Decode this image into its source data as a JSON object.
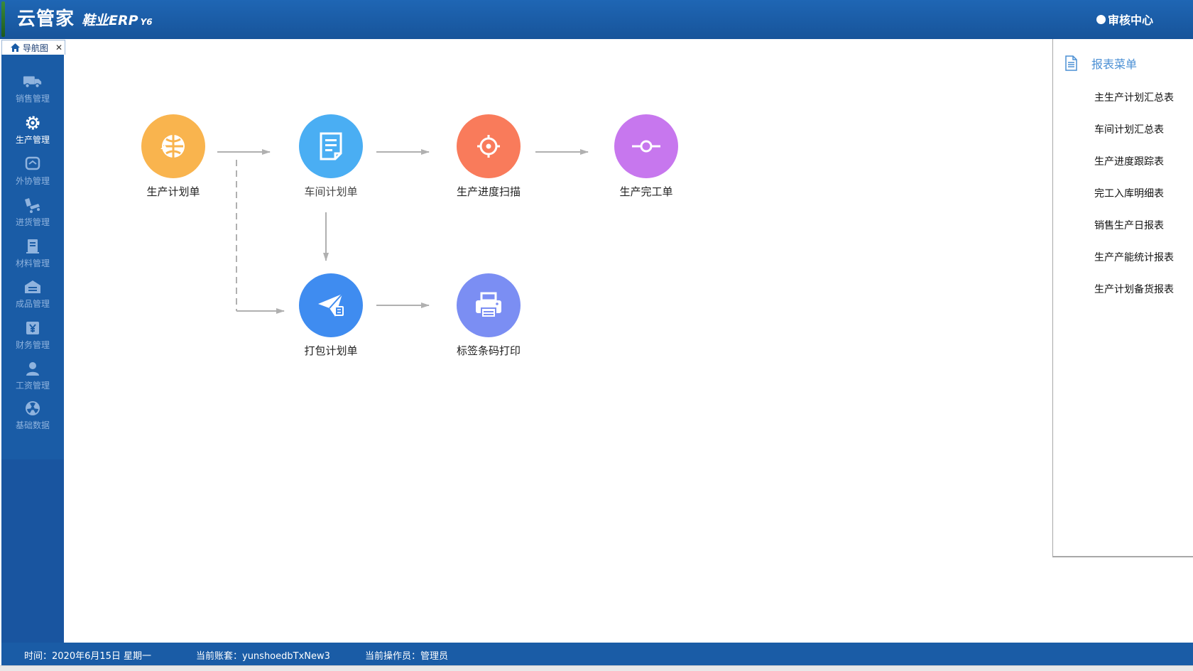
{
  "app": {
    "brand": "云管家",
    "product": "鞋业ERP",
    "version": "Y6",
    "audit_center": "审核中心"
  },
  "tabs": [
    {
      "label": "导航图"
    }
  ],
  "sidebar": {
    "items": [
      {
        "label": "销售管理",
        "icon": "truck-icon"
      },
      {
        "label": "生产管理",
        "icon": "gear-icon"
      },
      {
        "label": "外协管理",
        "icon": "handshake-icon"
      },
      {
        "label": "进货管理",
        "icon": "cart-icon"
      },
      {
        "label": "材料管理",
        "icon": "document-icon"
      },
      {
        "label": "成品管理",
        "icon": "warehouse-icon"
      },
      {
        "label": "财务管理",
        "icon": "yuan-icon"
      },
      {
        "label": "工资管理",
        "icon": "person-icon"
      },
      {
        "label": "基础数据",
        "icon": "radiation-icon"
      }
    ],
    "active_index": 1
  },
  "flow": {
    "nodes": [
      {
        "label": "生产计划单",
        "color": "#f9b44e",
        "icon": "globe-icon"
      },
      {
        "label": "车间计划单",
        "color": "#4aaef3",
        "icon": "document-icon"
      },
      {
        "label": "生产进度扫描",
        "color": "#f97b5b",
        "icon": "crosshair-icon"
      },
      {
        "label": "生产完工单",
        "color": "#c777ee",
        "icon": "commit-icon"
      },
      {
        "label": "打包计划单",
        "color": "#3f8cf0",
        "icon": "send-icon"
      },
      {
        "label": "标签条码打印",
        "color": "#7b8ef3",
        "icon": "printer-icon"
      }
    ]
  },
  "report_menu": {
    "title": "报表菜单",
    "icon": "report-icon",
    "items": [
      "主生产计划汇总表",
      "车间计划汇总表",
      "生产进度跟踪表",
      "完工入库明细表",
      "销售生产日报表",
      "生产产能统计报表",
      "生产计划备货报表"
    ]
  },
  "status_bar": {
    "time": "时间：2020年6月15日 星期一",
    "account": "当前账套：yunshoedbTxNew3",
    "operator": "当前操作员：管理员"
  }
}
